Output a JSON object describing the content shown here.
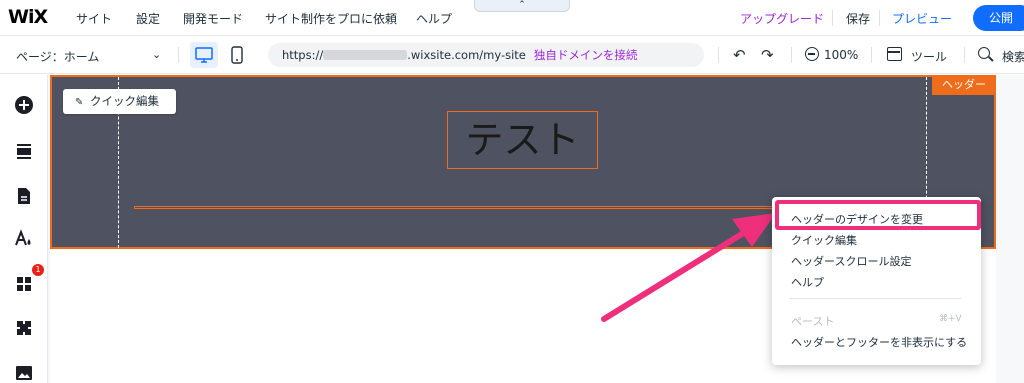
{
  "topbar": {
    "logo": "WiX",
    "menu": [
      "サイト",
      "設定",
      "開発モード",
      "サイト制作をプロに依頼",
      "ヘルプ"
    ],
    "collapse_glyph": "⌃",
    "upgrade": "アップグレード",
    "save": "保存",
    "preview": "プレビュー",
    "publish": "公開"
  },
  "subbar": {
    "page_label": "ページ：ホーム",
    "page_chevron": "⌄",
    "url_prefix": "https://",
    "url_suffix": ".wixsite.com/my-site",
    "domain_link": "独自ドメインを接続",
    "zoom": "100%",
    "tools": "ツール",
    "search": "検索"
  },
  "canvas": {
    "quick_edit": "クイック編集",
    "header_tag": "ヘッダー",
    "site_title": "テスト"
  },
  "context_menu": {
    "items": [
      "ヘッダーのデザインを変更",
      "クイック編集",
      "ヘッダースクロール設定",
      "ヘルプ"
    ],
    "paste": "ペースト",
    "paste_shortcut": "⌘+V",
    "hide": "ヘッダーとフッターを非表示にする"
  },
  "sidebar": {
    "apps_badge": "1"
  },
  "colors": {
    "accent": "#116dff",
    "upgrade": "#9a27d5",
    "selection": "#ef6c1a",
    "highlight": "#ee2f7c",
    "header_bg": "#4f5260"
  }
}
